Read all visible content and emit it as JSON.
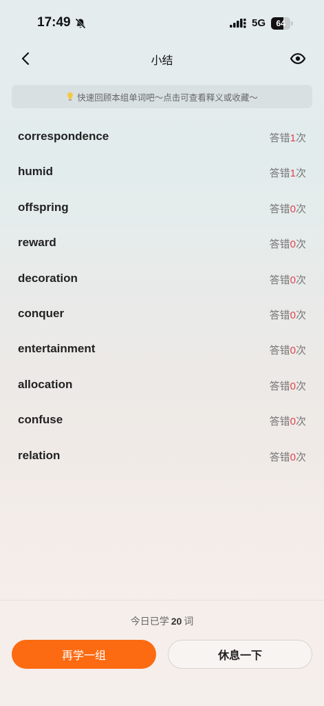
{
  "status_bar": {
    "time": "17:49",
    "network": "5G",
    "battery": "64",
    "battery_level": 0.64
  },
  "header": {
    "title": "小结"
  },
  "hint": {
    "text": "快速回顾本组单词吧～点击可查看释义或收藏～"
  },
  "words": [
    {
      "word": "correspondence",
      "prefix": "答错",
      "count": "1",
      "suffix": "次"
    },
    {
      "word": "humid",
      "prefix": "答错",
      "count": "1",
      "suffix": "次"
    },
    {
      "word": "offspring",
      "prefix": "答错",
      "count": "0",
      "suffix": "次"
    },
    {
      "word": "reward",
      "prefix": "答错",
      "count": "0",
      "suffix": "次"
    },
    {
      "word": "decoration",
      "prefix": "答错",
      "count": "0",
      "suffix": "次"
    },
    {
      "word": "conquer",
      "prefix": "答错",
      "count": "0",
      "suffix": "次"
    },
    {
      "word": "entertainment",
      "prefix": "答错",
      "count": "0",
      "suffix": "次"
    },
    {
      "word": "allocation",
      "prefix": "答错",
      "count": "0",
      "suffix": "次"
    },
    {
      "word": "confuse",
      "prefix": "答错",
      "count": "0",
      "suffix": "次"
    },
    {
      "word": "relation",
      "prefix": "答错",
      "count": "0",
      "suffix": "次"
    }
  ],
  "footer": {
    "stats_prefix": "今日已学",
    "stats_count": "20",
    "stats_suffix": "词",
    "again_label": "再学一组",
    "rest_label": "休息一下"
  },
  "colors": {
    "accent": "#fc6a11",
    "wrong_count": "#e0414d"
  }
}
